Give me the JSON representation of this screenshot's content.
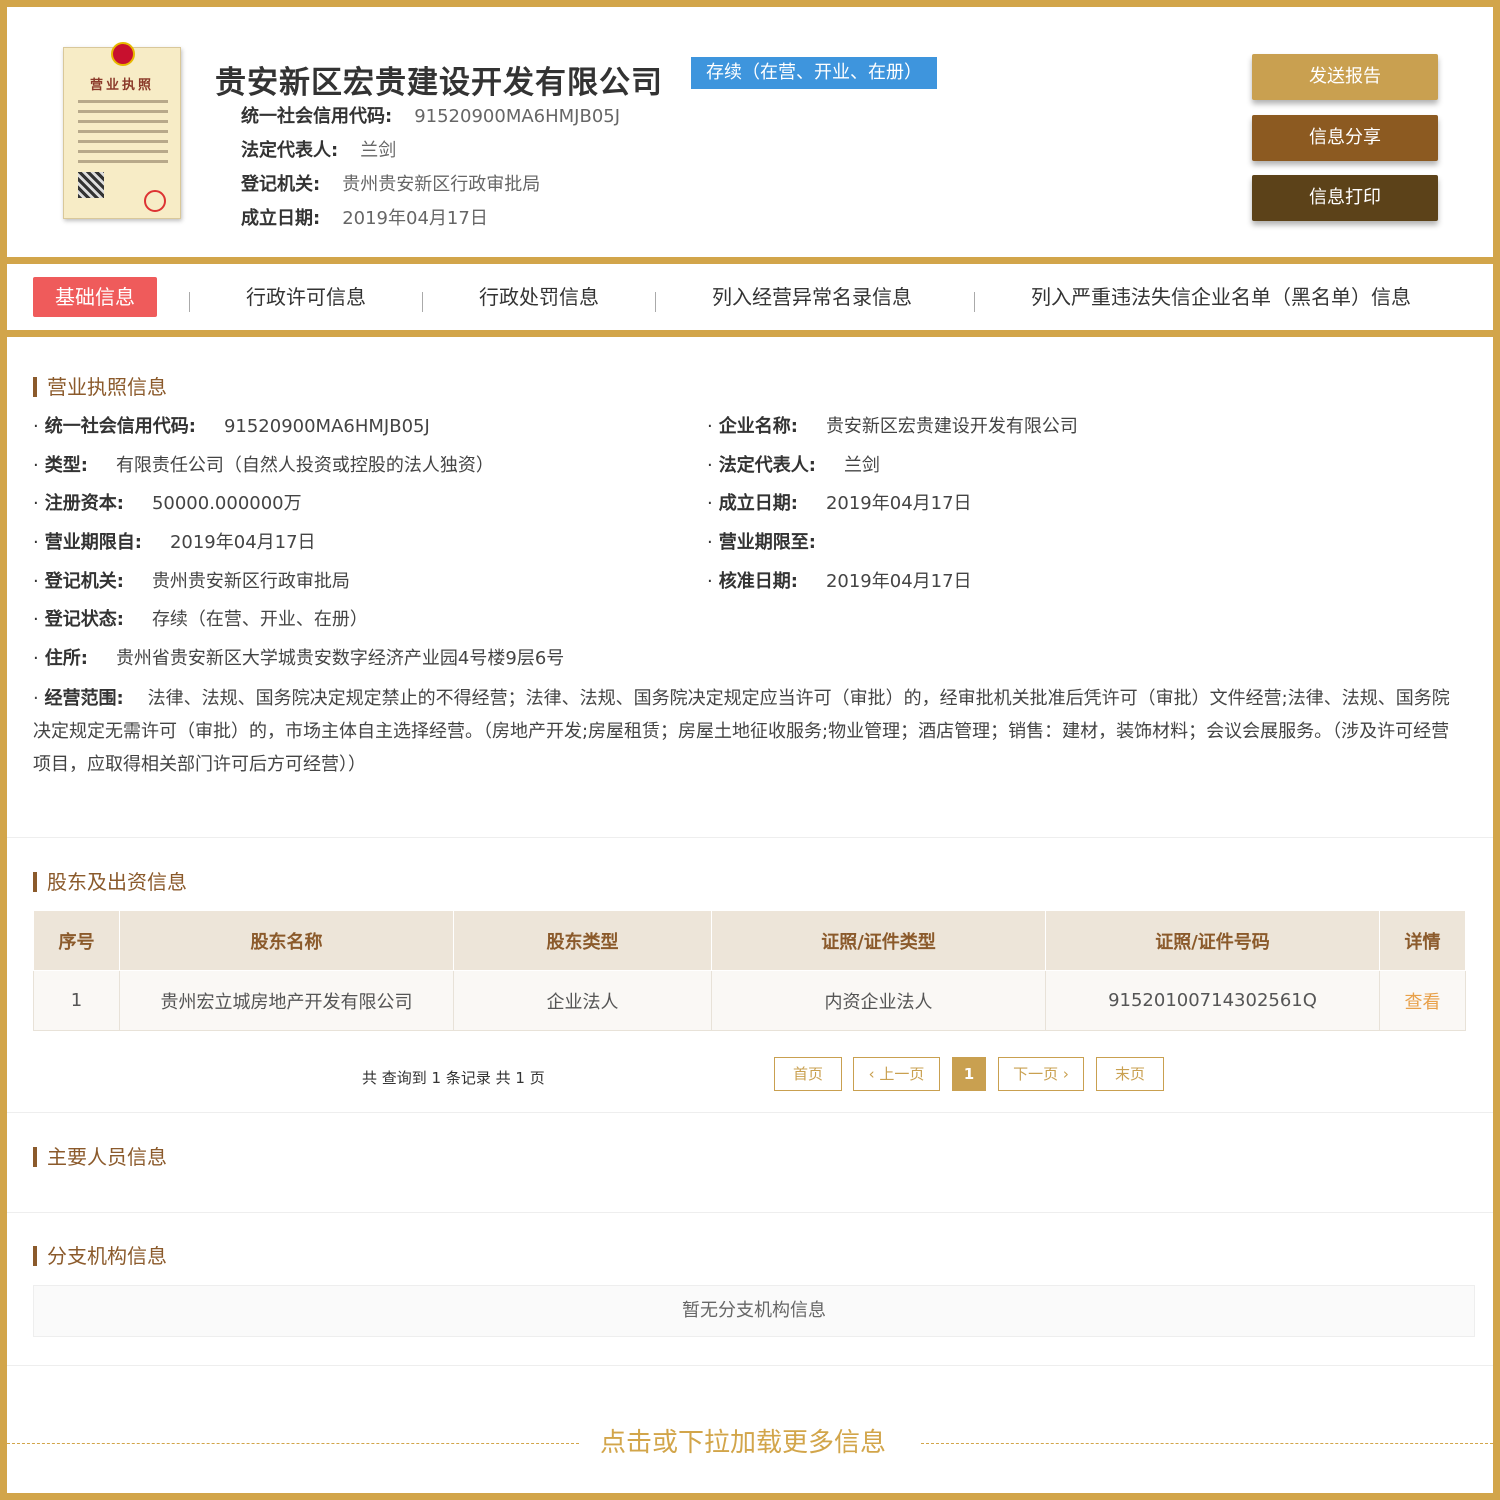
{
  "header": {
    "company_name": "贵安新区宏贵建设开发有限公司",
    "status": "存续（在营、开业、在册）",
    "license_title": "营业执照",
    "fields": [
      {
        "label": "统一社会信用代码:",
        "value": "91520900MA6HMJB05J"
      },
      {
        "label": "法定代表人:",
        "value": "兰剑"
      },
      {
        "label": "登记机关:",
        "value": "贵州贵安新区行政审批局"
      },
      {
        "label": "成立日期:",
        "value": "2019年04月17日"
      }
    ],
    "buttons": {
      "send_report": "发送报告",
      "share": "信息分享",
      "print": "信息打印"
    }
  },
  "tabs": [
    "基础信息",
    "行政许可信息",
    "行政处罚信息",
    "列入经营异常名录信息",
    "列入严重违法失信企业名单（黑名单）信息"
  ],
  "license_section": {
    "title": "营业执照信息",
    "left": [
      {
        "label": "统一社会信用代码:",
        "value": "91520900MA6HMJB05J"
      },
      {
        "label": "类型:",
        "value": "有限责任公司（自然人投资或控股的法人独资）"
      },
      {
        "label": "注册资本:",
        "value": "50000.000000万"
      },
      {
        "label": "营业期限自:",
        "value": "2019年04月17日"
      },
      {
        "label": "登记机关:",
        "value": "贵州贵安新区行政审批局"
      },
      {
        "label": "登记状态:",
        "value": "存续（在营、开业、在册）"
      },
      {
        "label": "住所:",
        "value": "贵州省贵安新区大学城贵安数字经济产业园4号楼9层6号"
      }
    ],
    "right": [
      {
        "label": "企业名称:",
        "value": "贵安新区宏贵建设开发有限公司"
      },
      {
        "label": "法定代表人:",
        "value": "兰剑"
      },
      {
        "label": "成立日期:",
        "value": "2019年04月17日"
      },
      {
        "label": "营业期限至:",
        "value": ""
      },
      {
        "label": "核准日期:",
        "value": "2019年04月17日"
      }
    ],
    "scope_label": "经营范围:",
    "scope_value": "法律、法规、国务院决定规定禁止的不得经营；法律、法规、国务院决定规定应当许可（审批）的，经审批机关批准后凭许可（审批）文件经营;法律、法规、国务院决定规定无需许可（审批）的，市场主体自主选择经营。（房地产开发;房屋租赁；房屋土地征收服务;物业管理；酒店管理；销售：建材，装饰材料；会议会展服务。（涉及许可经营项目，应取得相关部门许可后方可经营））"
  },
  "shareholder_section": {
    "title": "股东及出资信息",
    "columns": [
      "序号",
      "股东名称",
      "股东类型",
      "证照/证件类型",
      "证照/证件号码",
      "详情"
    ],
    "rows": [
      [
        "1",
        "贵州宏立城房地产开发有限公司",
        "企业法人",
        "内资企业法人",
        "91520100714302561Q",
        "查看"
      ]
    ],
    "pager": {
      "summary": "共 查询到 1 条记录 共 1 页",
      "first": "首页",
      "prev": "上一页",
      "current": "1",
      "next": "下一页",
      "last": "末页"
    }
  },
  "personnel_section": {
    "title": "主要人员信息"
  },
  "branch_section": {
    "title": "分支机构信息",
    "empty_text": "暂无分支机构信息"
  },
  "load_more": "点击或下拉加载更多信息",
  "colors": {
    "gold": "#d2a54a",
    "brown": "#8b5a2b",
    "status_blue": "#3e95dd",
    "active_tab": "#ef5b5b"
  }
}
